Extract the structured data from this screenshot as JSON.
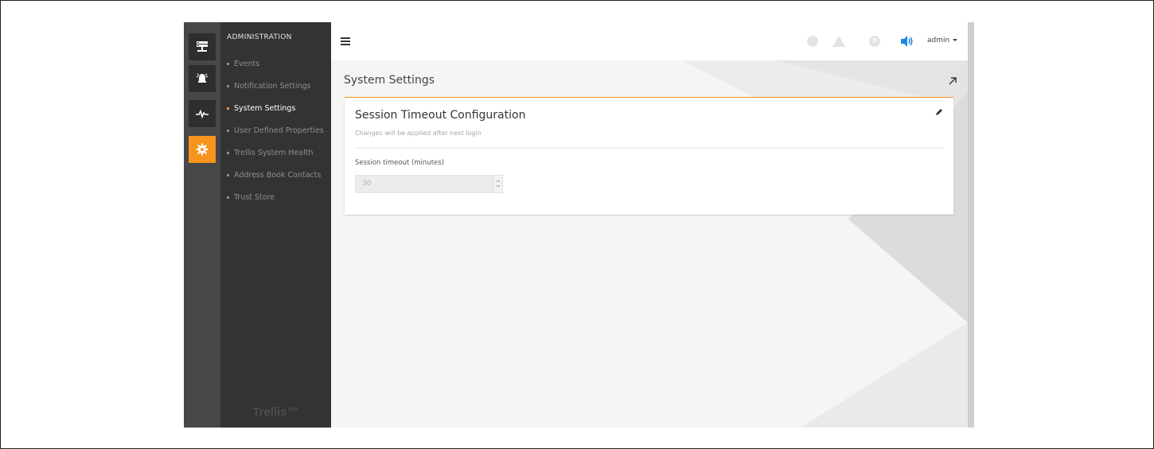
{
  "rail": {
    "items": [
      {
        "icon": "server-icon",
        "active": false
      },
      {
        "icon": "alarm-bell-icon",
        "active": false
      },
      {
        "icon": "heartbeat-icon",
        "active": false
      },
      {
        "icon": "gear-icon",
        "active": true
      }
    ]
  },
  "menu": {
    "title": "ADMINISTRATION",
    "items": [
      {
        "label": "Events",
        "active": false
      },
      {
        "label": "Notification Settings",
        "active": false
      },
      {
        "label": "System Settings",
        "active": true
      },
      {
        "label": "User Defined Properties",
        "active": false
      },
      {
        "label": "Trellis System Health",
        "active": false
      },
      {
        "label": "Address Book Contacts",
        "active": false
      },
      {
        "label": "Trust Store",
        "active": false
      }
    ],
    "brand": "Trellis™"
  },
  "topbar": {
    "status_icons": [
      "info-circle-icon",
      "warning-triangle-icon",
      "error-x-icon"
    ],
    "sound_icon": "speaker-icon",
    "user": "admin"
  },
  "page": {
    "title": "System Settings"
  },
  "card": {
    "title": "Session Timeout Configuration",
    "subtitle": "Changes will be applied after next login",
    "field_label": "Session timeout (minutes)",
    "field_value": "30"
  },
  "colors": {
    "accent": "#f7941d",
    "sidebar": "#333333",
    "rail": "#474747",
    "speaker_blue": "#1e88e5"
  }
}
